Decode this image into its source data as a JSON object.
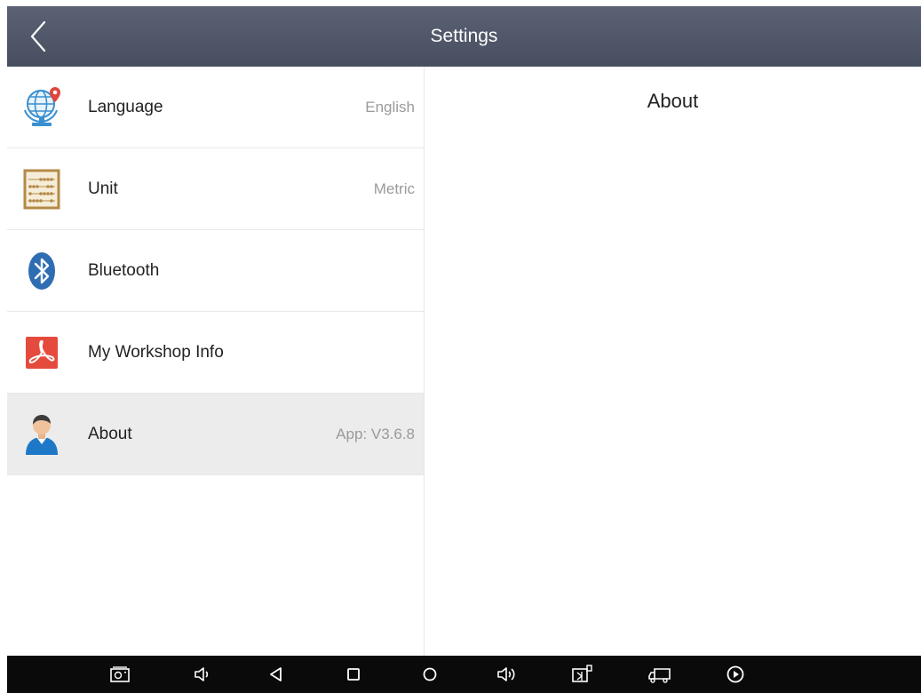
{
  "header": {
    "title": "Settings",
    "back_icon": "chevron-left-icon"
  },
  "settings_list": {
    "items": [
      {
        "id": "language",
        "icon": "globe-pin-icon",
        "label": "Language",
        "value": "English",
        "selected": false
      },
      {
        "id": "unit",
        "icon": "abacus-icon",
        "label": "Unit",
        "value": "Metric",
        "selected": false
      },
      {
        "id": "bluetooth",
        "icon": "bluetooth-icon",
        "label": "Bluetooth",
        "value": "",
        "selected": false
      },
      {
        "id": "workshop",
        "icon": "pdf-icon",
        "label": "My Workshop Info",
        "value": "",
        "selected": false
      },
      {
        "id": "about",
        "icon": "user-icon",
        "label": "About",
        "value": "App: V3.6.8",
        "selected": true
      }
    ]
  },
  "detail": {
    "title": "About"
  },
  "nav_bar": {
    "buttons": [
      {
        "id": "screenshot",
        "icon": "camera-icon"
      },
      {
        "id": "volume-down",
        "icon": "volume-down-icon"
      },
      {
        "id": "back",
        "icon": "back-triangle-icon"
      },
      {
        "id": "recents",
        "icon": "square-icon"
      },
      {
        "id": "home",
        "icon": "circle-icon"
      },
      {
        "id": "volume-up",
        "icon": "volume-up-icon"
      },
      {
        "id": "vci",
        "icon": "vci-connector-icon"
      },
      {
        "id": "truck",
        "icon": "truck-icon"
      },
      {
        "id": "play",
        "icon": "play-circle-icon"
      }
    ]
  },
  "colors": {
    "title_bar": "#4f5668",
    "selected_row": "#ececec",
    "nav_bar": "#0a0a0a",
    "value_text": "#9a9a9a"
  }
}
